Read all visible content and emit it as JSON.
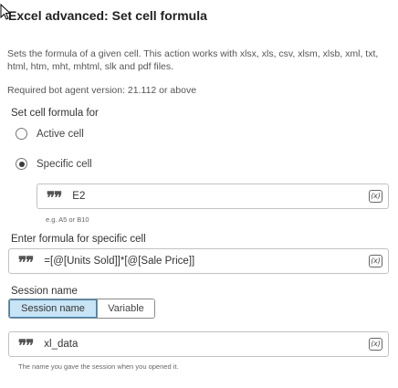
{
  "title": "Excel advanced: Set cell formula",
  "description": "Sets the formula of a given cell. This action works with xlsx, xls, csv, xlsm, xlsb, xml, txt, html, htm, mht, mhtml, slk and pdf files.",
  "required_version": "Required bot agent version: 21.112 or above",
  "cell_target": {
    "label": "Set cell formula for",
    "options": [
      "Active cell",
      "Specific cell"
    ],
    "selected": "Specific cell",
    "cell_value": "E2",
    "cell_hint": "e.g. A5 or B10"
  },
  "formula": {
    "label": "Enter formula for specific cell",
    "value": "=[@[Units Sold]]*[@[Sale Price]]"
  },
  "session": {
    "label": "Session name",
    "toggle_options": [
      "Session name",
      "Variable"
    ],
    "selected": "Session name",
    "value": "xl_data",
    "hint": "The name you gave the session when you opened it."
  },
  "icons": {
    "quote": "quote-icon",
    "variable": "variable-insert-icon",
    "variable_glyph": "(x)",
    "quote_glyph": "❞❞"
  }
}
